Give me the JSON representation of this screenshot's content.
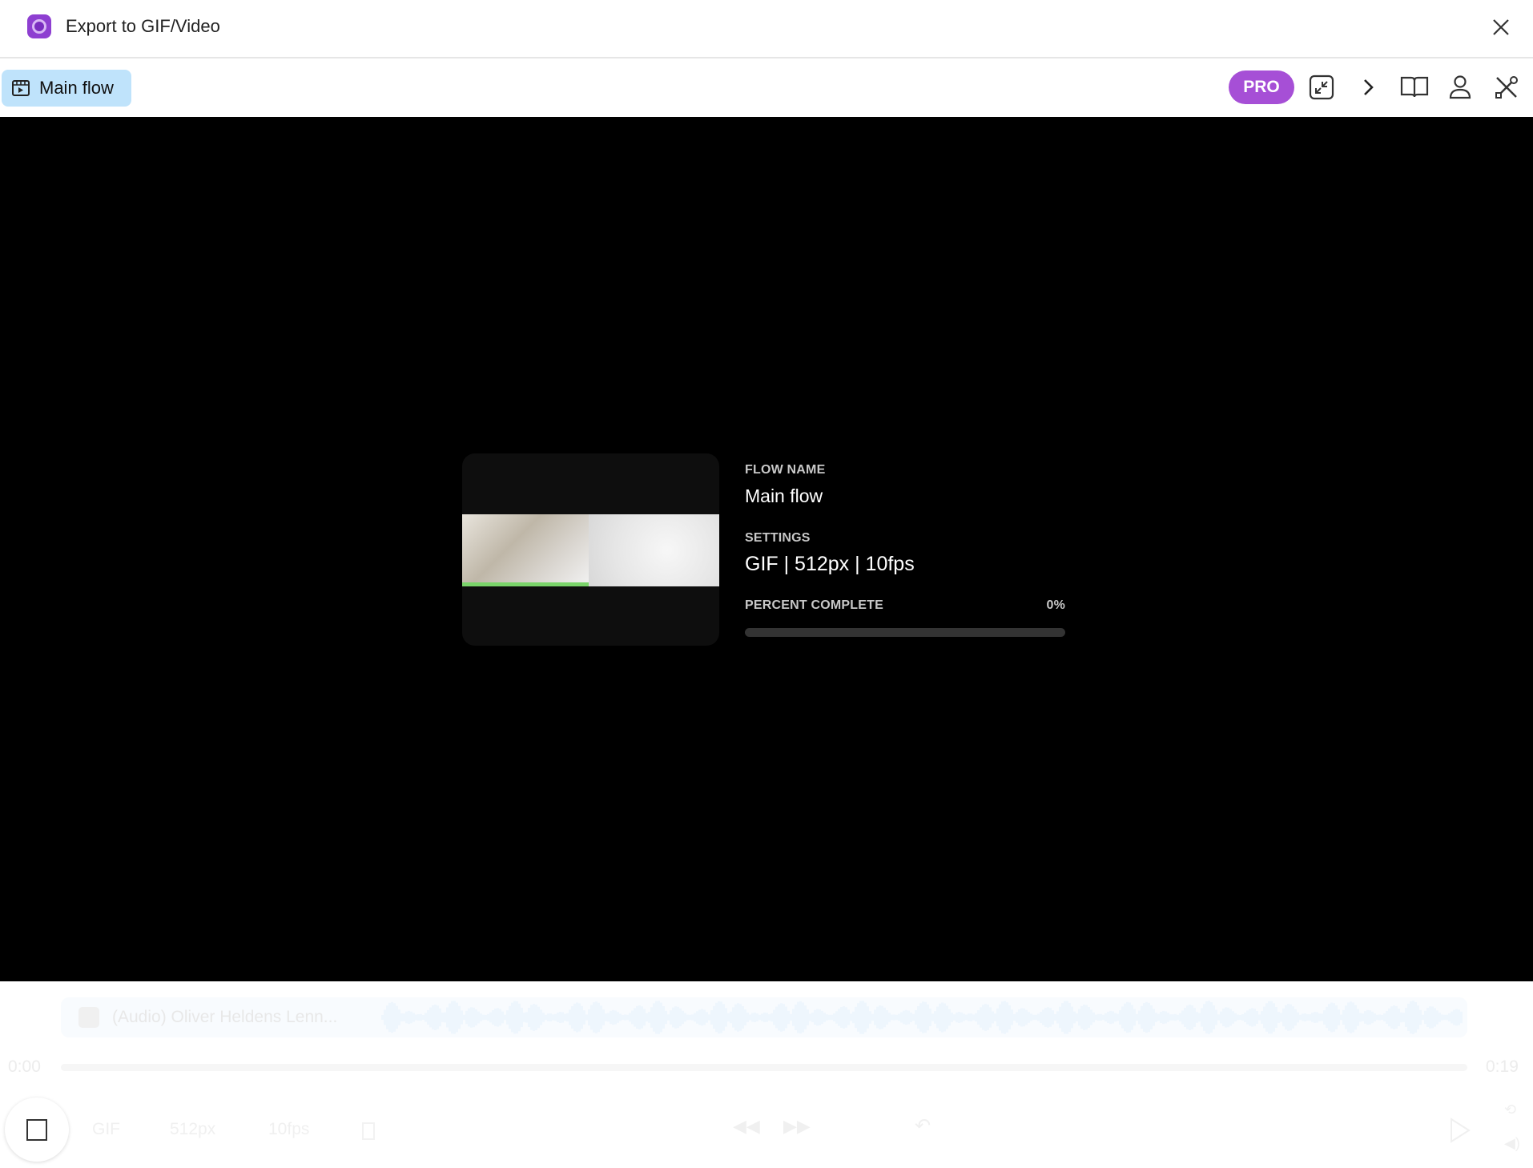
{
  "window": {
    "title": "Export to GIF/Video"
  },
  "toolbar": {
    "flow_chip": "Main flow",
    "pro_badge": "PRO",
    "icons": [
      "collapse-icon",
      "chevron-right-icon",
      "book-icon",
      "user-icon",
      "tools-icon"
    ]
  },
  "export": {
    "flow_name_label": "FLOW NAME",
    "flow_name": "Main flow",
    "settings_label": "SETTINGS",
    "settings_value": "GIF | 512px | 10fps",
    "percent_label": "PERCENT COMPLETE",
    "percent_value": "0%",
    "progress": 0
  },
  "player": {
    "audio_track": "(Audio) Oliver Heldens Lenn...",
    "time_start": "0:00",
    "time_end": "0:19",
    "format": "GIF",
    "size": "512px",
    "fps": "10fps"
  },
  "colors": {
    "accent": "#a64fd6",
    "chip": "#bfe3fb",
    "stage": "#000000"
  }
}
